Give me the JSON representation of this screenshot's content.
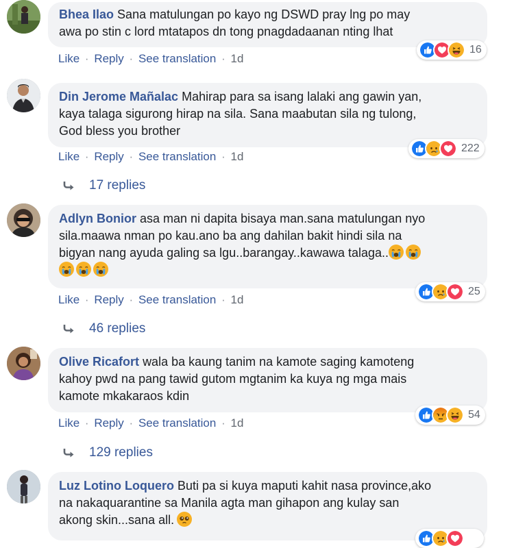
{
  "actions": {
    "like": "Like",
    "reply": "Reply",
    "translate": "See translation",
    "separator": "·"
  },
  "comments": [
    {
      "author": "Bhea Ilao",
      "text": "Sana matulungan po kayo ng DSWD pray lng po may\nawa po stin c lord mtatapos dn tong pnagdadaanan nting lhat",
      "time": "1d",
      "reactions": [
        "like-icon",
        "love-icon",
        "haha-icon"
      ],
      "reaction_count": "16"
    },
    {
      "author": "Din Jerome Mañalac",
      "text": "Mahirap para sa isang lalaki ang gawin yan,\nkaya talaga sigurong hirap na sila. Sana maabutan sila ng tulong,\nGod bless you brother",
      "time": "1d",
      "reactions": [
        "like-icon",
        "sad-icon",
        "love-icon"
      ],
      "reaction_count": "222",
      "replies": "17 replies"
    },
    {
      "author": "Adlyn Bonior",
      "text": "asa man ni dapita bisaya man.sana matulungan nyo\nsila.maawa nman po kau.ano ba ang dahilan bakit hindi sila na\nbigyan nang ayuda galing sa lgu..barangay..kawawa talaga..",
      "time": "1d",
      "reactions": [
        "like-icon",
        "sad-icon",
        "love-icon"
      ],
      "reaction_count": "25",
      "replies": "46 replies"
    },
    {
      "author": "Olive Ricafort",
      "text": "wala ba kaung tanim na kamote saging kamoteng\nkahoy pwd na pang tawid gutom mgtanim ka kuya ng mga mais\nkamote mkakaraos kdin",
      "time": "1d",
      "reactions": [
        "like-icon",
        "angry-icon",
        "haha-icon"
      ],
      "reaction_count": "54",
      "replies": "129 replies"
    },
    {
      "author": "Luz Lotino Loquero",
      "text": "Buti pa si kuya maputi kahit nasa province,ako\nna nakaquarantine sa Manila agta man gihapon ang kulay san\nakong skin...sana all."
    }
  ],
  "colors": {
    "link": "#385898",
    "bubble": "#f2f3f5",
    "like": "#1877f2",
    "love": "#f33e58",
    "haha": "#f7b125"
  }
}
